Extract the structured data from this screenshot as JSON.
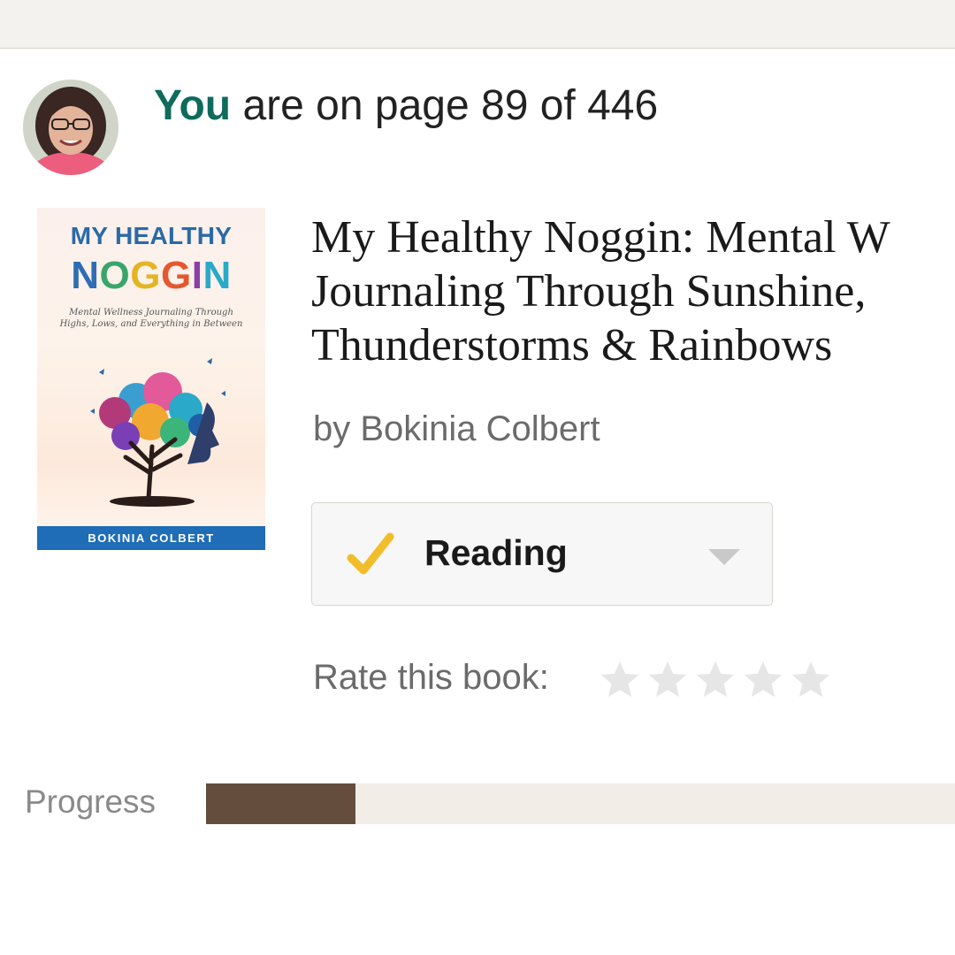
{
  "status": {
    "you_label": "You",
    "page_text": "are on page 89 of 446",
    "current_page": 89,
    "total_pages": 446
  },
  "book": {
    "title": "My Healthy Noggin: Mental Wellness Journaling Through Sunshine, Thunderstorms & Rainbows",
    "title_line1": "My Healthy Noggin: Mental W",
    "title_line2": "Journaling Through Sunshine,",
    "title_line3": "Thunderstorms & Rainbows",
    "author_line": "by Bokinia Colbert",
    "cover": {
      "line1": "MY HEALTHY",
      "line2_letters": [
        "N",
        "O",
        "G",
        "G",
        "I",
        "N"
      ],
      "line2_colors": [
        "#2e6db4",
        "#3aa56a",
        "#e5b423",
        "#e5572f",
        "#8a3fa4",
        "#2aa9c9"
      ],
      "subtitle": "Mental Wellness Journaling Through Highs, Lows, and Everything in Between",
      "author_band": "BOKINIA COLBERT"
    }
  },
  "shelf": {
    "status_label": "Reading",
    "check_color": "#f2bd2b"
  },
  "rating": {
    "label": "Rate this book:",
    "value": 0,
    "max": 5
  },
  "progress": {
    "label": "Progress",
    "fraction": 0.1996,
    "color": "#654d3d"
  },
  "colors": {
    "accent": "#0f6b5c"
  }
}
